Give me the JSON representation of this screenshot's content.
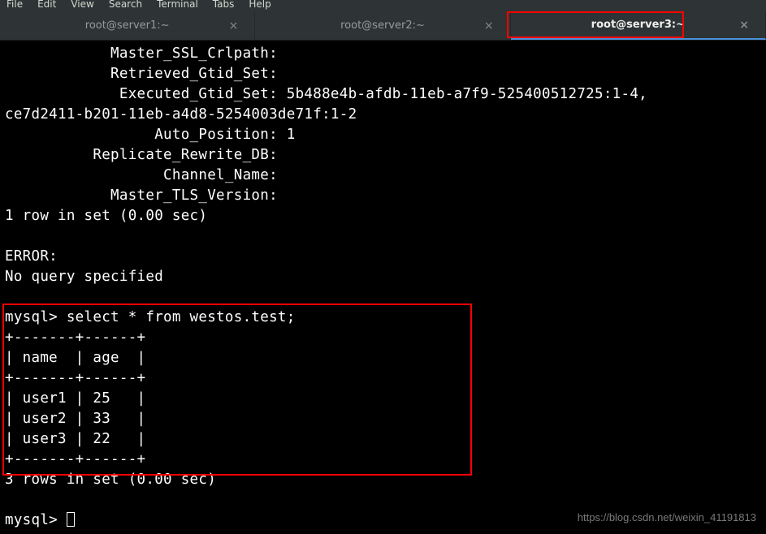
{
  "menu": {
    "items": [
      "File",
      "Edit",
      "View",
      "Search",
      "Terminal",
      "Tabs",
      "Help"
    ]
  },
  "tabs": [
    {
      "label": "root@server1:~",
      "active": false
    },
    {
      "label": "root@server2:~",
      "active": false
    },
    {
      "label": "root@server3:~",
      "active": true
    }
  ],
  "terminal_output": {
    "lines": [
      "            Master_SSL_Crlpath:",
      "            Retrieved_Gtid_Set:",
      "             Executed_Gtid_Set: 5b488e4b-afdb-11eb-a7f9-525400512725:1-4,",
      "ce7d2411-b201-11eb-a4d8-5254003de71f:1-2",
      "                 Auto_Position: 1",
      "          Replicate_Rewrite_DB:",
      "                  Channel_Name:",
      "            Master_TLS_Version:",
      "1 row in set (0.00 sec)",
      "",
      "ERROR:",
      "No query specified",
      "",
      "mysql> select * from westos.test;",
      "+-------+------+",
      "| name  | age  |",
      "+-------+------+",
      "| user1 | 25   |",
      "| user2 | 33   |",
      "| user3 | 22   |",
      "+-------+------+",
      "3 rows in set (0.00 sec)",
      "",
      "mysql> "
    ]
  },
  "chart_data": {
    "type": "table",
    "query": "select * from westos.test;",
    "columns": [
      "name",
      "age"
    ],
    "rows": [
      {
        "name": "user1",
        "age": 25
      },
      {
        "name": "user2",
        "age": 33
      },
      {
        "name": "user3",
        "age": 22
      }
    ],
    "row_count": 3,
    "query_time_sec": 0.0
  },
  "watermark": "https://blog.csdn.net/weixin_41191813"
}
